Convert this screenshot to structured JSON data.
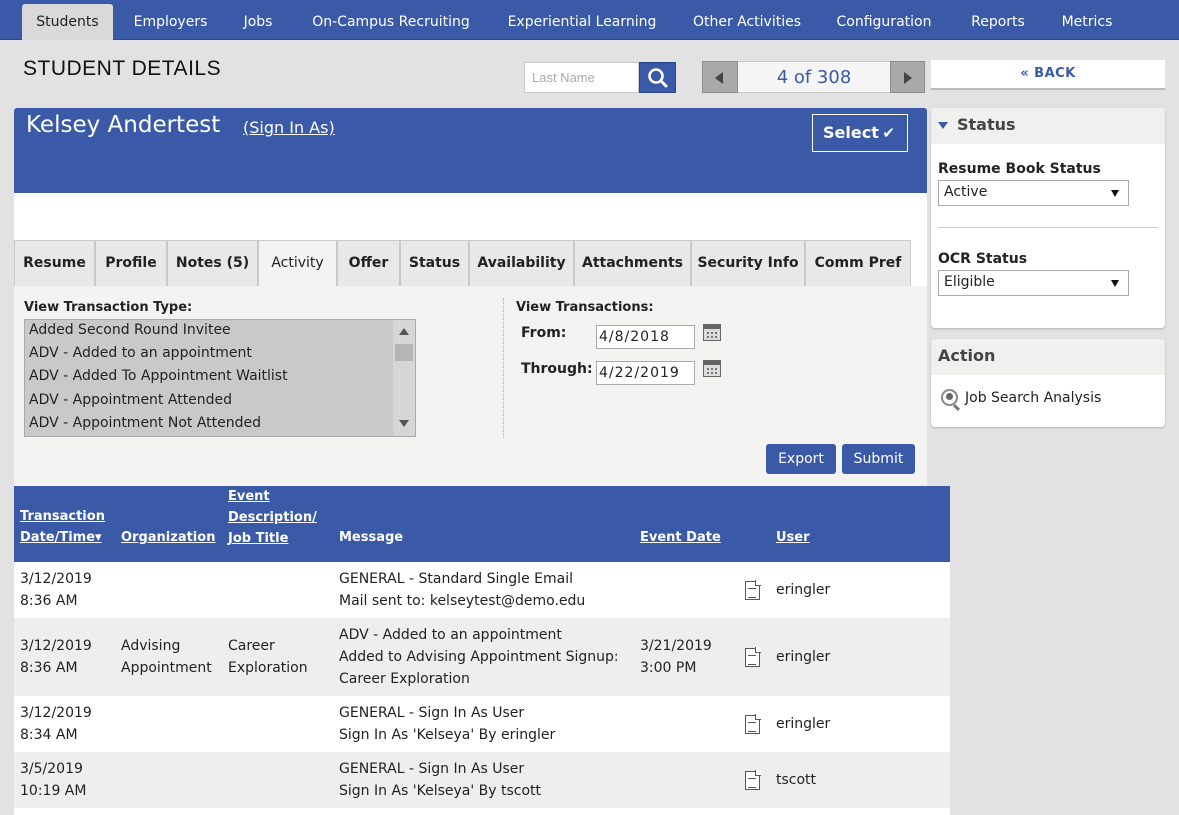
{
  "nav": {
    "tabs": [
      "Students",
      "Employers",
      "Jobs",
      "On-Campus Recruiting",
      "Experiential Learning",
      "Other Activities",
      "Configuration",
      "Reports",
      "Metrics"
    ],
    "active": "Students"
  },
  "header": {
    "page_title": "STUDENT DETAILS",
    "search_placeholder": "Last Name",
    "pager_text": "4 of 308",
    "back_label": "« BACK"
  },
  "student": {
    "name": "Kelsey Andertest",
    "sign_in_as": "(Sign In As)",
    "select_label": "Select",
    "select_check": "✔"
  },
  "subtabs": [
    "Resume",
    "Profile",
    "Notes (5)",
    "Activity",
    "Offer",
    "Status",
    "Availability",
    "Attachments",
    "Security Info",
    "Comm Pref"
  ],
  "filters": {
    "type_label": "View Transaction Type:",
    "type_options": [
      "Added Second Round Invitee",
      "ADV - Added to an appointment",
      "ADV - Added To Appointment Waitlist",
      "ADV - Appointment Attended",
      "ADV - Appointment Not Attended"
    ],
    "transactions_label": "View Transactions:",
    "from_label": "From:",
    "from_value": "4/8/2018",
    "through_label": "Through:",
    "through_value": "4/22/2019",
    "export_label": "Export",
    "submit_label": "Submit"
  },
  "table": {
    "headers": {
      "date_line1": "Transaction",
      "date_line2": "Date/Time▾",
      "organization": "Organization",
      "event_line1": "Event",
      "event_line2": "Description/",
      "event_line3": "Job Title",
      "message": "Message",
      "event_date": "Event Date",
      "user": "User"
    },
    "rows": [
      {
        "date": "3/12/2019",
        "time": "8:36 AM",
        "org1": "",
        "org2": "",
        "job1": "",
        "job2": "",
        "msg1": "GENERAL - Standard Single Email",
        "msg2": "Mail sent to: kelseytest@demo.edu",
        "msg3": "",
        "evdate": "",
        "evtime": "",
        "user": "eringler"
      },
      {
        "date": "3/12/2019",
        "time": "8:36 AM",
        "org1": "Advising",
        "org2": "Appointment",
        "job1": "Career",
        "job2": "Exploration",
        "msg1": "ADV - Added to an appointment",
        "msg2": "Added to Advising Appointment Signup:",
        "msg3": "Career Exploration",
        "evdate": "3/21/2019",
        "evtime": "3:00 PM",
        "user": "eringler"
      },
      {
        "date": "3/12/2019",
        "time": "8:34 AM",
        "org1": "",
        "org2": "",
        "job1": "",
        "job2": "",
        "msg1": "GENERAL - Sign In As User",
        "msg2": "Sign In As 'Kelseya' By eringler",
        "msg3": "",
        "evdate": "",
        "evtime": "",
        "user": "eringler"
      },
      {
        "date": "3/5/2019",
        "time": "10:19 AM",
        "org1": "",
        "org2": "",
        "job1": "",
        "job2": "",
        "msg1": "GENERAL - Sign In As User",
        "msg2": "Sign In As 'Kelseya' By tscott",
        "msg3": "",
        "evdate": "",
        "evtime": "",
        "user": "tscott"
      }
    ]
  },
  "sidebar": {
    "status_title": "Status",
    "resume_book_label": "Resume Book Status",
    "resume_book_value": "Active",
    "ocr_label": "OCR Status",
    "ocr_value": "Eligible",
    "action_title": "Action",
    "action_item": "Job Search Analysis"
  },
  "colors": {
    "brand_blue": "#3a5aa8",
    "nav_active": "#d9d9d9"
  }
}
